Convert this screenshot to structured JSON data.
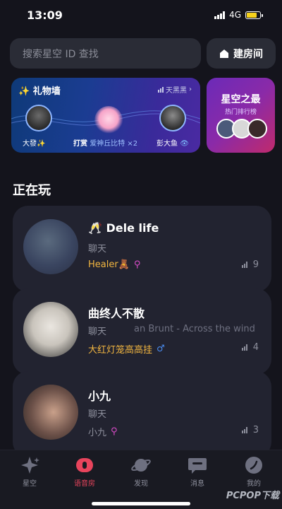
{
  "status_bar": {
    "time": "13:09",
    "network": "4G"
  },
  "search": {
    "placeholder": "搜索星空 ID 查找"
  },
  "build_room": {
    "label": "建房间"
  },
  "gift_wall": {
    "title": "✨ 礼物墙",
    "link": "天黑黑",
    "sender": "大發✨",
    "action": "打赏",
    "gift": "爱神丘比特 ×2",
    "receiver": "彭大鱼"
  },
  "ranking": {
    "title": "星空之最",
    "subtitle": "热门排行榜"
  },
  "section": {
    "title": "正在玩"
  },
  "rooms": [
    {
      "name": "🥂 Dele life",
      "category": "聊天",
      "song": "",
      "host": "Healer🧸",
      "count": "9"
    },
    {
      "name": "曲终人不散",
      "category": "聊天",
      "song": "an Brunt - Across the wind",
      "host": "大红灯笼高高挂",
      "count": "4"
    },
    {
      "name": "小九",
      "category": "聊天",
      "song": "",
      "host": "小九",
      "count": "3"
    }
  ],
  "tabs": [
    {
      "label": "星空",
      "icon": "sparkle-icon"
    },
    {
      "label": "语音房",
      "icon": "voice-room-icon"
    },
    {
      "label": "发现",
      "icon": "planet-icon"
    },
    {
      "label": "消息",
      "icon": "message-icon"
    },
    {
      "label": "我的",
      "icon": "profile-icon"
    }
  ],
  "watermark": "PCPOP下载",
  "colors": {
    "accent": "#e8445c",
    "host_text": "#f2b640",
    "card_bg": "#222330"
  }
}
